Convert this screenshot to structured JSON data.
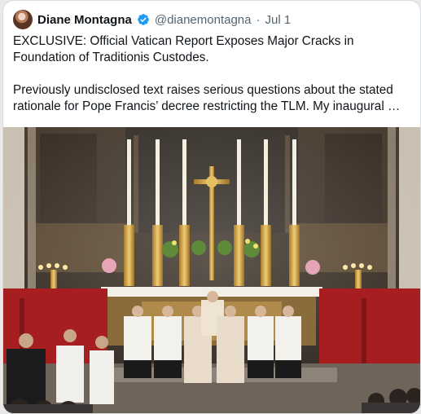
{
  "tweet": {
    "author_name": "Diane Montagna",
    "handle": "@dianemontagna",
    "separator": "·",
    "date": "Jul 1",
    "headline": "EXCLUSIVE: Official Vatican Report Exposes Major Cracks in Foundation of Traditionis Custodes.",
    "body": "Previously undisclosed text raises serious questions about the stated rationale for Pope Francis’ decree restricting the TLM. My inaugural …"
  },
  "icons": {
    "avatar": "profile-photo",
    "verified": "verified-badge-icon"
  },
  "colors": {
    "verified_blue": "#1d9bf0",
    "text_primary": "#0f1419",
    "text_secondary": "#536471"
  }
}
